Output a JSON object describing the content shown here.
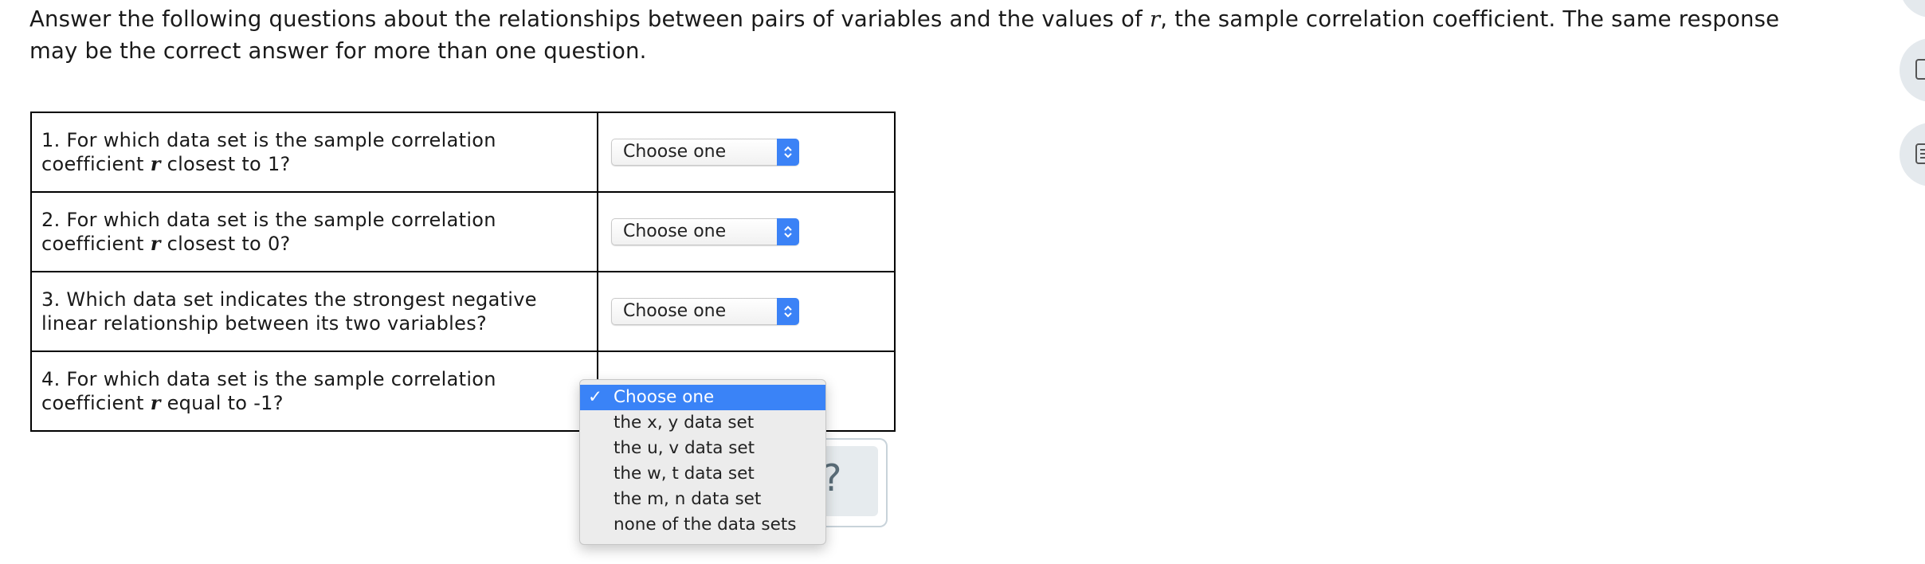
{
  "intro": {
    "text_a": "Answer the following questions about the relationships between pairs of variables and the values of ",
    "r": "r",
    "text_b": ", the sample correlation coefficient. The same response may be the correct answer for more than one question."
  },
  "questions": [
    {
      "pre": "1. For which data set is the sample correlation coefficient ",
      "r": "r",
      "post": " closest to 1?",
      "value": "Choose one"
    },
    {
      "pre": "2. For which data set is the sample correlation coefficient ",
      "r": "r",
      "post": " closest to 0?",
      "value": "Choose one"
    },
    {
      "pre": "3. Which data set indicates the strongest negative linear relationship between its two variables?",
      "r": "",
      "post": "",
      "value": "Choose one"
    },
    {
      "pre": "4. For which data set is the sample correlation coefficient ",
      "r": "r",
      "post": " equal to -1?",
      "value": "Choose one"
    }
  ],
  "dropdown": {
    "options": [
      "Choose one",
      "the x, y data set",
      "the u, v data set",
      "the w, t data set",
      "the m, n data set",
      "none of the data sets"
    ],
    "selected_index": 0,
    "check": "✓"
  },
  "help": {
    "symbol": "?"
  },
  "colors": {
    "accent": "#3a83f7",
    "help_bg": "#e6ebee"
  },
  "icons": [
    "up-down-arrows-icon",
    "checkmark-icon",
    "help-question-icon",
    "side-action-icon"
  ]
}
